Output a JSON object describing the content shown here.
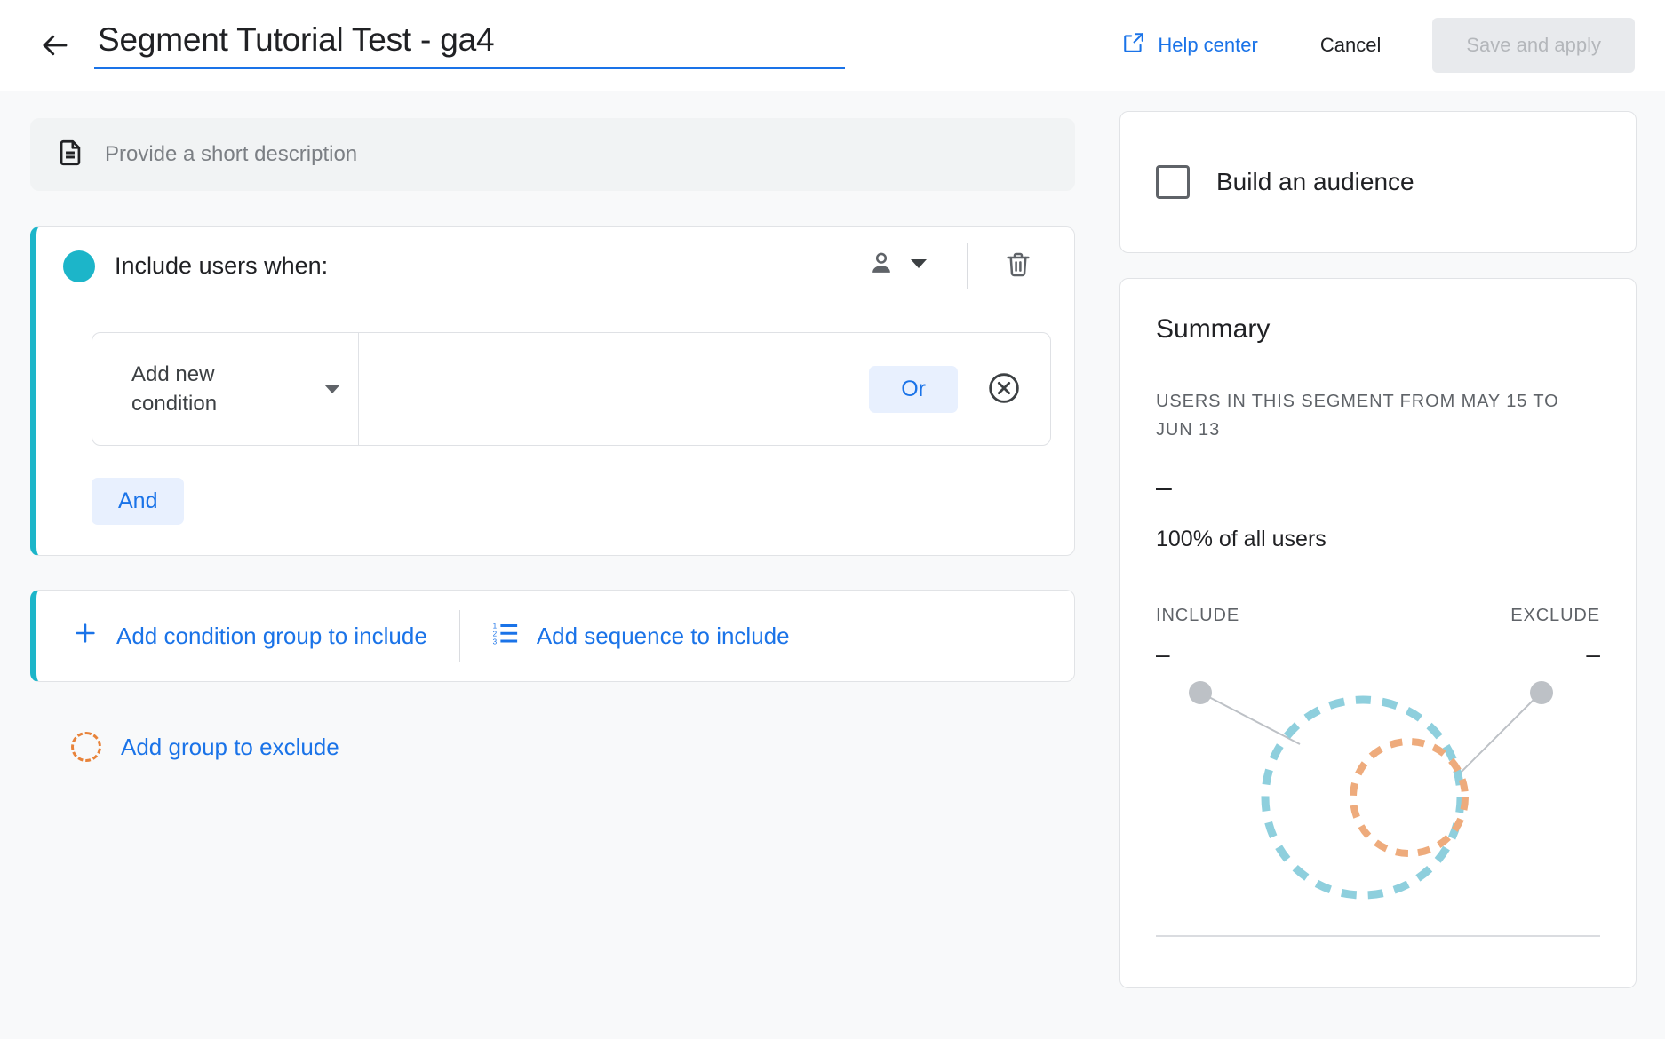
{
  "header": {
    "back_icon": "arrow-left-icon",
    "title_value": "Segment Tutorial Test - ga4",
    "title_placeholder": "Name your segment",
    "help_icon": "open-in-new-icon",
    "help_label": "Help center",
    "cancel_label": "Cancel",
    "save_label": "Save and apply",
    "accent_blue": "#1a73e8"
  },
  "description": {
    "icon": "document-icon",
    "placeholder": "Provide a short description",
    "value": ""
  },
  "include_card": {
    "accent_color": "#1cb5c9",
    "status_dot": "filled-circle-icon",
    "heading": "Include users when:",
    "scope_icon": "person-icon",
    "scope_caret": "chevron-down-icon",
    "delete_icon": "trash-icon",
    "condition": {
      "select_label": "Add new condition",
      "select_caret": "dropdown-caret-icon",
      "or_label": "Or",
      "remove_icon": "close-circle-icon"
    },
    "and_label": "And"
  },
  "add_actions": {
    "accent_color": "#1cb5c9",
    "add_condition_group_icon": "plus-icon",
    "add_condition_group_label": "Add condition group to include",
    "add_sequence_icon": "numbered-list-icon",
    "add_sequence_label": "Add sequence to include"
  },
  "exclude_action": {
    "icon": "dashed-circle-icon",
    "label": "Add group to exclude",
    "icon_color": "#e8833a"
  },
  "audience": {
    "checkbox_icon": "checkbox-unchecked-icon",
    "label": "Build an audience",
    "checked": false
  },
  "summary": {
    "title": "Summary",
    "caption": "USERS IN THIS SEGMENT FROM MAY 15 TO JUN 13",
    "value": "–",
    "percent_of_all": "100% of all users",
    "include_label": "INCLUDE",
    "exclude_label": "EXCLUDE",
    "include_value": "–",
    "exclude_value": "–",
    "venn": {
      "include_circle_color": "#8ecfdd",
      "exclude_circle_color": "#eeab7c",
      "leader_dot_color": "#bdc1c6"
    }
  }
}
